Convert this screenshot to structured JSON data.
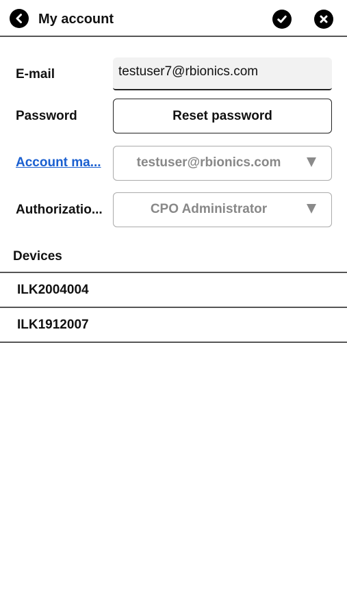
{
  "header": {
    "title": "My account",
    "back_icon": "chevron-left-circle-icon",
    "confirm_icon": "check-circle-icon",
    "close_icon": "close-circle-icon"
  },
  "form": {
    "email": {
      "label": "E-mail",
      "value": "testuser7@rbionics.com"
    },
    "password": {
      "label": "Password",
      "button_label": "Reset password"
    },
    "account_manager": {
      "label": "Account ma...",
      "value": "testuser@rbionics.com"
    },
    "authorization": {
      "label": "Authorizatio...",
      "value": "CPO Administrator"
    }
  },
  "devices": {
    "title": "Devices",
    "items": [
      {
        "label": "ILK2004004"
      },
      {
        "label": "ILK1912007"
      }
    ]
  },
  "colors": {
    "link": "#1a5fd0",
    "disabled_text": "#888888",
    "divider": "#555555"
  }
}
